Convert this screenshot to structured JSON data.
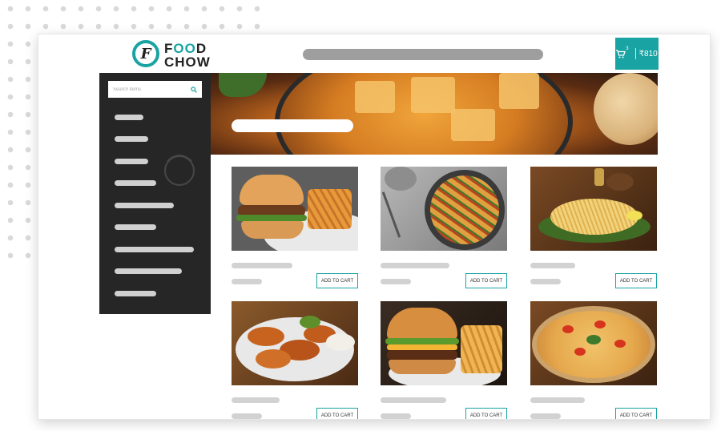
{
  "brand": {
    "logo_mark": "F",
    "logo_line1_a": "F",
    "logo_line1_b": "OO",
    "logo_line1_c": "D",
    "logo_line2": "CHOW",
    "accent_color": "#1aa3a3"
  },
  "header": {
    "cart_count": "3",
    "cart_total": "₹810",
    "cart_icon": "cart-icon"
  },
  "sidebar": {
    "search_placeholder": "Search items",
    "search_icon": "search-icon",
    "category_count": 9
  },
  "products": [
    {
      "image": "burger-with-fries",
      "button_label": "ADD TO CART"
    },
    {
      "image": "penne-pasta",
      "button_label": "ADD TO CART"
    },
    {
      "image": "noodles-on-leaf",
      "button_label": "ADD TO CART"
    },
    {
      "image": "chicken-wings",
      "button_label": "ADD TO CART"
    },
    {
      "image": "cheese-burger-fries",
      "button_label": "ADD TO CART"
    },
    {
      "image": "pizza",
      "button_label": "ADD TO CART"
    }
  ]
}
